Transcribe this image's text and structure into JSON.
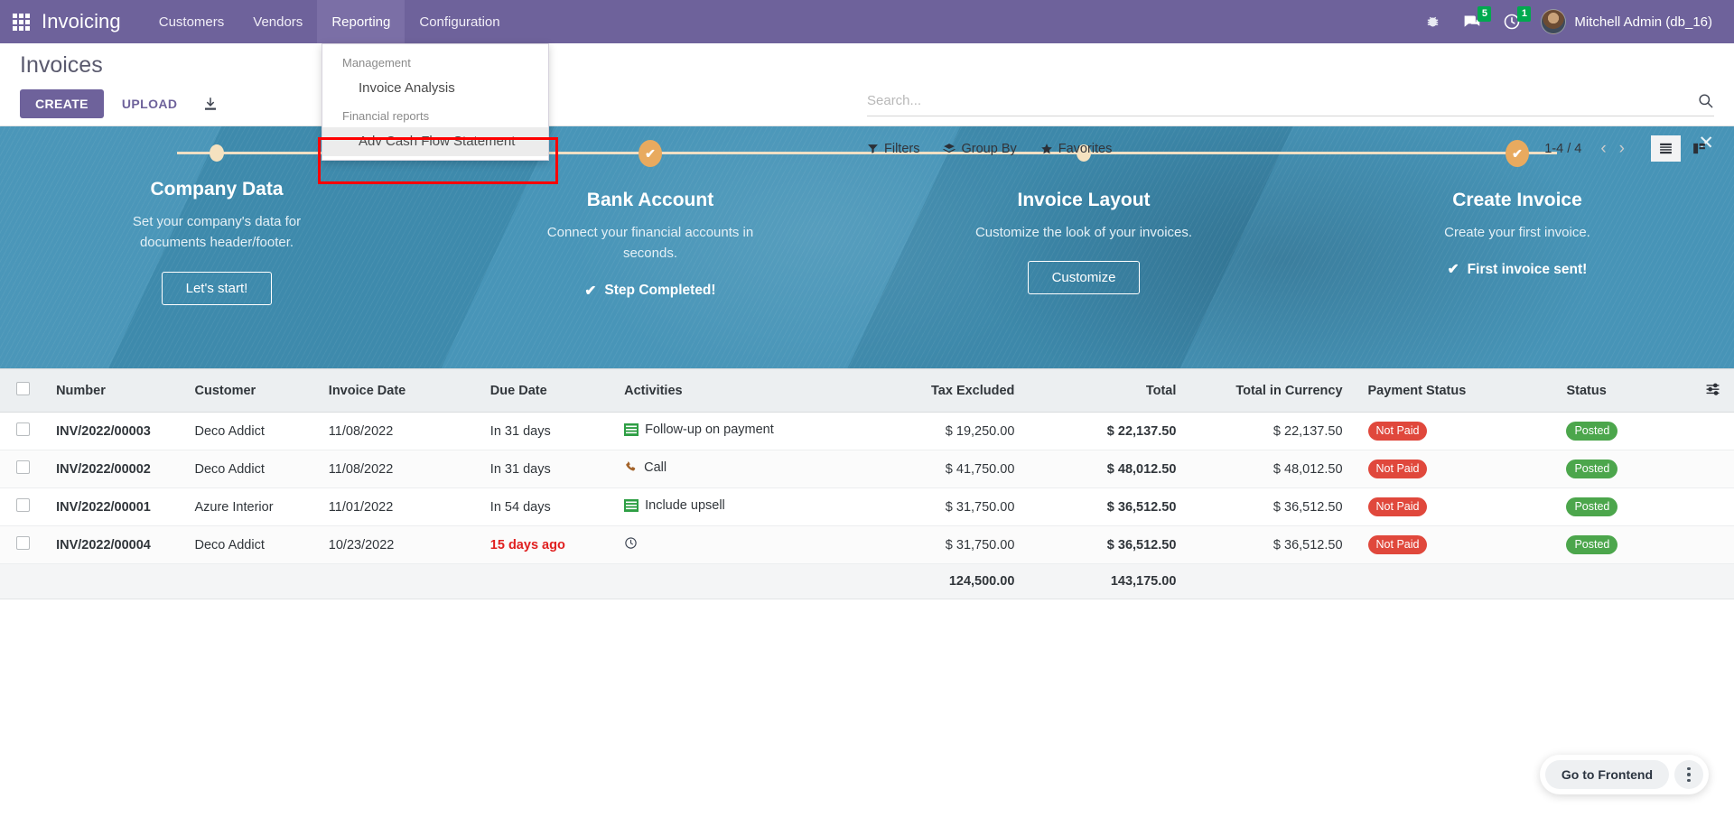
{
  "navbar": {
    "apps_icon": "apps-grid-icon",
    "brand": "Invoicing",
    "menus": [
      {
        "label": "Customers",
        "active": false
      },
      {
        "label": "Vendors",
        "active": false
      },
      {
        "label": "Reporting",
        "active": true
      },
      {
        "label": "Configuration",
        "active": false
      }
    ],
    "right": {
      "bug_icon": "bug-icon",
      "messages_icon": "chat-bubble-icon",
      "messages_count": "5",
      "activities_icon": "clock-icon",
      "activities_count": "1",
      "avatar": "user-avatar",
      "user_name": "Mitchell Admin (db_16)"
    }
  },
  "dropdown": {
    "sections": [
      {
        "header": "Management",
        "items": [
          {
            "label": "Invoice Analysis",
            "hovered": false
          }
        ]
      },
      {
        "header": "Financial reports",
        "items": [
          {
            "label": "Adv Cash Flow Statement",
            "hovered": true
          }
        ]
      }
    ],
    "highlight_color": "#ff0000"
  },
  "control_panel": {
    "title": "Invoices",
    "create_label": "CREATE",
    "upload_label": "UPLOAD",
    "download_icon": "download-icon",
    "search": {
      "placeholder": "Search...",
      "value": "",
      "icon": "search-icon"
    },
    "filters": [
      {
        "label": "Filters",
        "icon": "funnel-icon"
      },
      {
        "label": "Group By",
        "icon": "layers-icon"
      },
      {
        "label": "Favorites",
        "icon": "star-icon"
      }
    ],
    "pager": {
      "range": "1-4 / 4",
      "prev_icon": "chevron-left-icon",
      "next_icon": "chevron-right-icon"
    },
    "views": [
      {
        "name": "list-view",
        "icon": "list-icon",
        "active": true
      },
      {
        "name": "kanban-view",
        "icon": "kanban-icon",
        "active": false
      }
    ]
  },
  "banner": {
    "background_color": "#4191b5",
    "close_icon": "close-icon",
    "steps": [
      {
        "title": "Company Data",
        "desc": "Set your company's data for documents header/footer.",
        "button": "Let's start!",
        "completed": false,
        "done_text": ""
      },
      {
        "title": "Bank Account",
        "desc": "Connect your financial accounts in seconds.",
        "button": "",
        "completed": true,
        "done_text": "Step Completed!"
      },
      {
        "title": "Invoice Layout",
        "desc": "Customize the look of your invoices.",
        "button": "Customize",
        "completed": false,
        "done_text": ""
      },
      {
        "title": "Create Invoice",
        "desc": "Create your first invoice.",
        "button": "",
        "completed": true,
        "done_text": "First invoice sent!"
      }
    ]
  },
  "table": {
    "columns": [
      "Number",
      "Customer",
      "Invoice Date",
      "Due Date",
      "Activities",
      "Tax Excluded",
      "Total",
      "Total in Currency",
      "Payment Status",
      "Status"
    ],
    "options_icon": "column-options-icon",
    "rows": [
      {
        "number": "INV/2022/00003",
        "customer": "Deco Addict",
        "invoice_date": "11/08/2022",
        "due_date": "In 31 days",
        "due_overdue": false,
        "activity_icon": "list-green-icon",
        "activity": "Follow-up on payment",
        "tax_excluded": "$ 19,250.00",
        "total": "$ 22,137.50",
        "total_currency": "$ 22,137.50",
        "payment_status": "Not Paid",
        "status": "Posted"
      },
      {
        "number": "INV/2022/00002",
        "customer": "Deco Addict",
        "invoice_date": "11/08/2022",
        "due_date": "In 31 days",
        "due_overdue": false,
        "activity_icon": "phone-icon",
        "activity": "Call",
        "tax_excluded": "$ 41,750.00",
        "total": "$ 48,012.50",
        "total_currency": "$ 48,012.50",
        "payment_status": "Not Paid",
        "status": "Posted"
      },
      {
        "number": "INV/2022/00001",
        "customer": "Azure Interior",
        "invoice_date": "11/01/2022",
        "due_date": "In 54 days",
        "due_overdue": false,
        "activity_icon": "list-green-icon",
        "activity": "Include upsell",
        "tax_excluded": "$ 31,750.00",
        "total": "$ 36,512.50",
        "total_currency": "$ 36,512.50",
        "payment_status": "Not Paid",
        "status": "Posted"
      },
      {
        "number": "INV/2022/00004",
        "customer": "Deco Addict",
        "invoice_date": "10/23/2022",
        "due_date": "15 days ago",
        "due_overdue": true,
        "activity_icon": "clock-outline-icon",
        "activity": "",
        "tax_excluded": "$ 31,750.00",
        "total": "$ 36,512.50",
        "total_currency": "$ 36,512.50",
        "payment_status": "Not Paid",
        "status": "Posted"
      }
    ],
    "footer": {
      "tax_excluded": "124,500.00",
      "total": "143,175.00"
    }
  },
  "frontend": {
    "label": "Go to Frontend",
    "kebab_icon": "kebab-menu-icon"
  },
  "colors": {
    "navbar_purple": "#6e629b",
    "banner_teal": "#4191b5",
    "badge_green": "#00a94f",
    "tag_red": "#e0483c",
    "tag_green": "#4ca64c",
    "overdue_red": "#e02020",
    "step_done_gold": "#e8aa5f"
  }
}
